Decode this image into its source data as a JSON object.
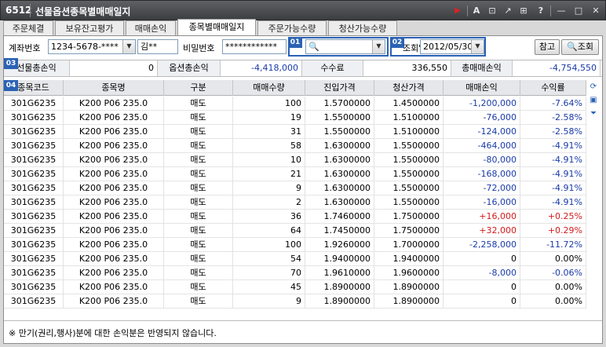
{
  "window": {
    "code": "6512",
    "title": "선물옵션종목별매매일지",
    "buttons": [
      "▶",
      "A",
      "⊡",
      "↗",
      "⊞",
      "?",
      "—",
      "□",
      "✕"
    ]
  },
  "tabs": [
    {
      "label": "주문체결"
    },
    {
      "label": "보유잔고평가"
    },
    {
      "label": "매매손익"
    },
    {
      "label": "종목별매매일지"
    },
    {
      "label": "주문가능수량"
    },
    {
      "label": "청산가능수량"
    }
  ],
  "search": {
    "account_label": "계좌번호",
    "account_value": "1234-5678-****",
    "name_value": "김**",
    "password_label": "비밀번호",
    "password_value": "************",
    "code_placeholder": "",
    "date_label": "조회일",
    "date_value": "2012/05/30",
    "ref_button": "참고",
    "query_button": "조회"
  },
  "badges": {
    "b01": "01",
    "b02": "02",
    "b03": "03",
    "b04": "04"
  },
  "summary": {
    "futures_label": "선물총손익",
    "futures_value": "0",
    "options_label": "옵션총손익",
    "options_value": "-4,418,000",
    "fee_label": "수수료",
    "fee_value": "336,550",
    "total_label": "총매매손익",
    "total_value": "-4,754,550"
  },
  "table": {
    "columns": [
      "종목코드",
      "종목명",
      "구분",
      "매매수량",
      "진입가격",
      "청산가격",
      "매매손익",
      "수익률"
    ],
    "rows": [
      [
        "301G6235",
        "K200 P06 235.0",
        "매도",
        "100",
        "1.5700000",
        "1.4500000",
        "-1,200,000",
        "-7.64%"
      ],
      [
        "301G6235",
        "K200 P06 235.0",
        "매도",
        "19",
        "1.5500000",
        "1.5100000",
        "-76,000",
        "-2.58%"
      ],
      [
        "301G6235",
        "K200 P06 235.0",
        "매도",
        "31",
        "1.5500000",
        "1.5100000",
        "-124,000",
        "-2.58%"
      ],
      [
        "301G6235",
        "K200 P06 235.0",
        "매도",
        "58",
        "1.6300000",
        "1.5500000",
        "-464,000",
        "-4.91%"
      ],
      [
        "301G6235",
        "K200 P06 235.0",
        "매도",
        "10",
        "1.6300000",
        "1.5500000",
        "-80,000",
        "-4.91%"
      ],
      [
        "301G6235",
        "K200 P06 235.0",
        "매도",
        "21",
        "1.6300000",
        "1.5500000",
        "-168,000",
        "-4.91%"
      ],
      [
        "301G6235",
        "K200 P06 235.0",
        "매도",
        "9",
        "1.6300000",
        "1.5500000",
        "-72,000",
        "-4.91%"
      ],
      [
        "301G6235",
        "K200 P06 235.0",
        "매도",
        "2",
        "1.6300000",
        "1.5500000",
        "-16,000",
        "-4.91%"
      ],
      [
        "301G6235",
        "K200 P06 235.0",
        "매도",
        "36",
        "1.7460000",
        "1.7500000",
        "+16,000",
        "+0.25%"
      ],
      [
        "301G6235",
        "K200 P06 235.0",
        "매도",
        "64",
        "1.7450000",
        "1.7500000",
        "+32,000",
        "+0.29%"
      ],
      [
        "301G6235",
        "K200 P06 235.0",
        "매도",
        "100",
        "1.9260000",
        "1.7000000",
        "-2,258,000",
        "-11.72%"
      ],
      [
        "301G6235",
        "K200 P06 235.0",
        "매도",
        "54",
        "1.9400000",
        "1.9400000",
        "0",
        "0.00%"
      ],
      [
        "301G6235",
        "K200 P06 235.0",
        "매도",
        "70",
        "1.9610000",
        "1.9600000",
        "-8,000",
        "-0.06%"
      ],
      [
        "301G6235",
        "K200 P06 235.0",
        "매도",
        "45",
        "1.8900000",
        "1.8900000",
        "0",
        "0.00%"
      ],
      [
        "301G6235",
        "K200 P06 235.0",
        "매도",
        "9",
        "1.8900000",
        "1.8900000",
        "0",
        "0.00%"
      ]
    ]
  },
  "footer_note": "※ 만기(권리,행사)분에 대한 손익분은 반영되지 않습니다.",
  "colors": {
    "negative": "#1a3aa8",
    "positive": "#d21b1b",
    "badge": "#2b62b5"
  }
}
